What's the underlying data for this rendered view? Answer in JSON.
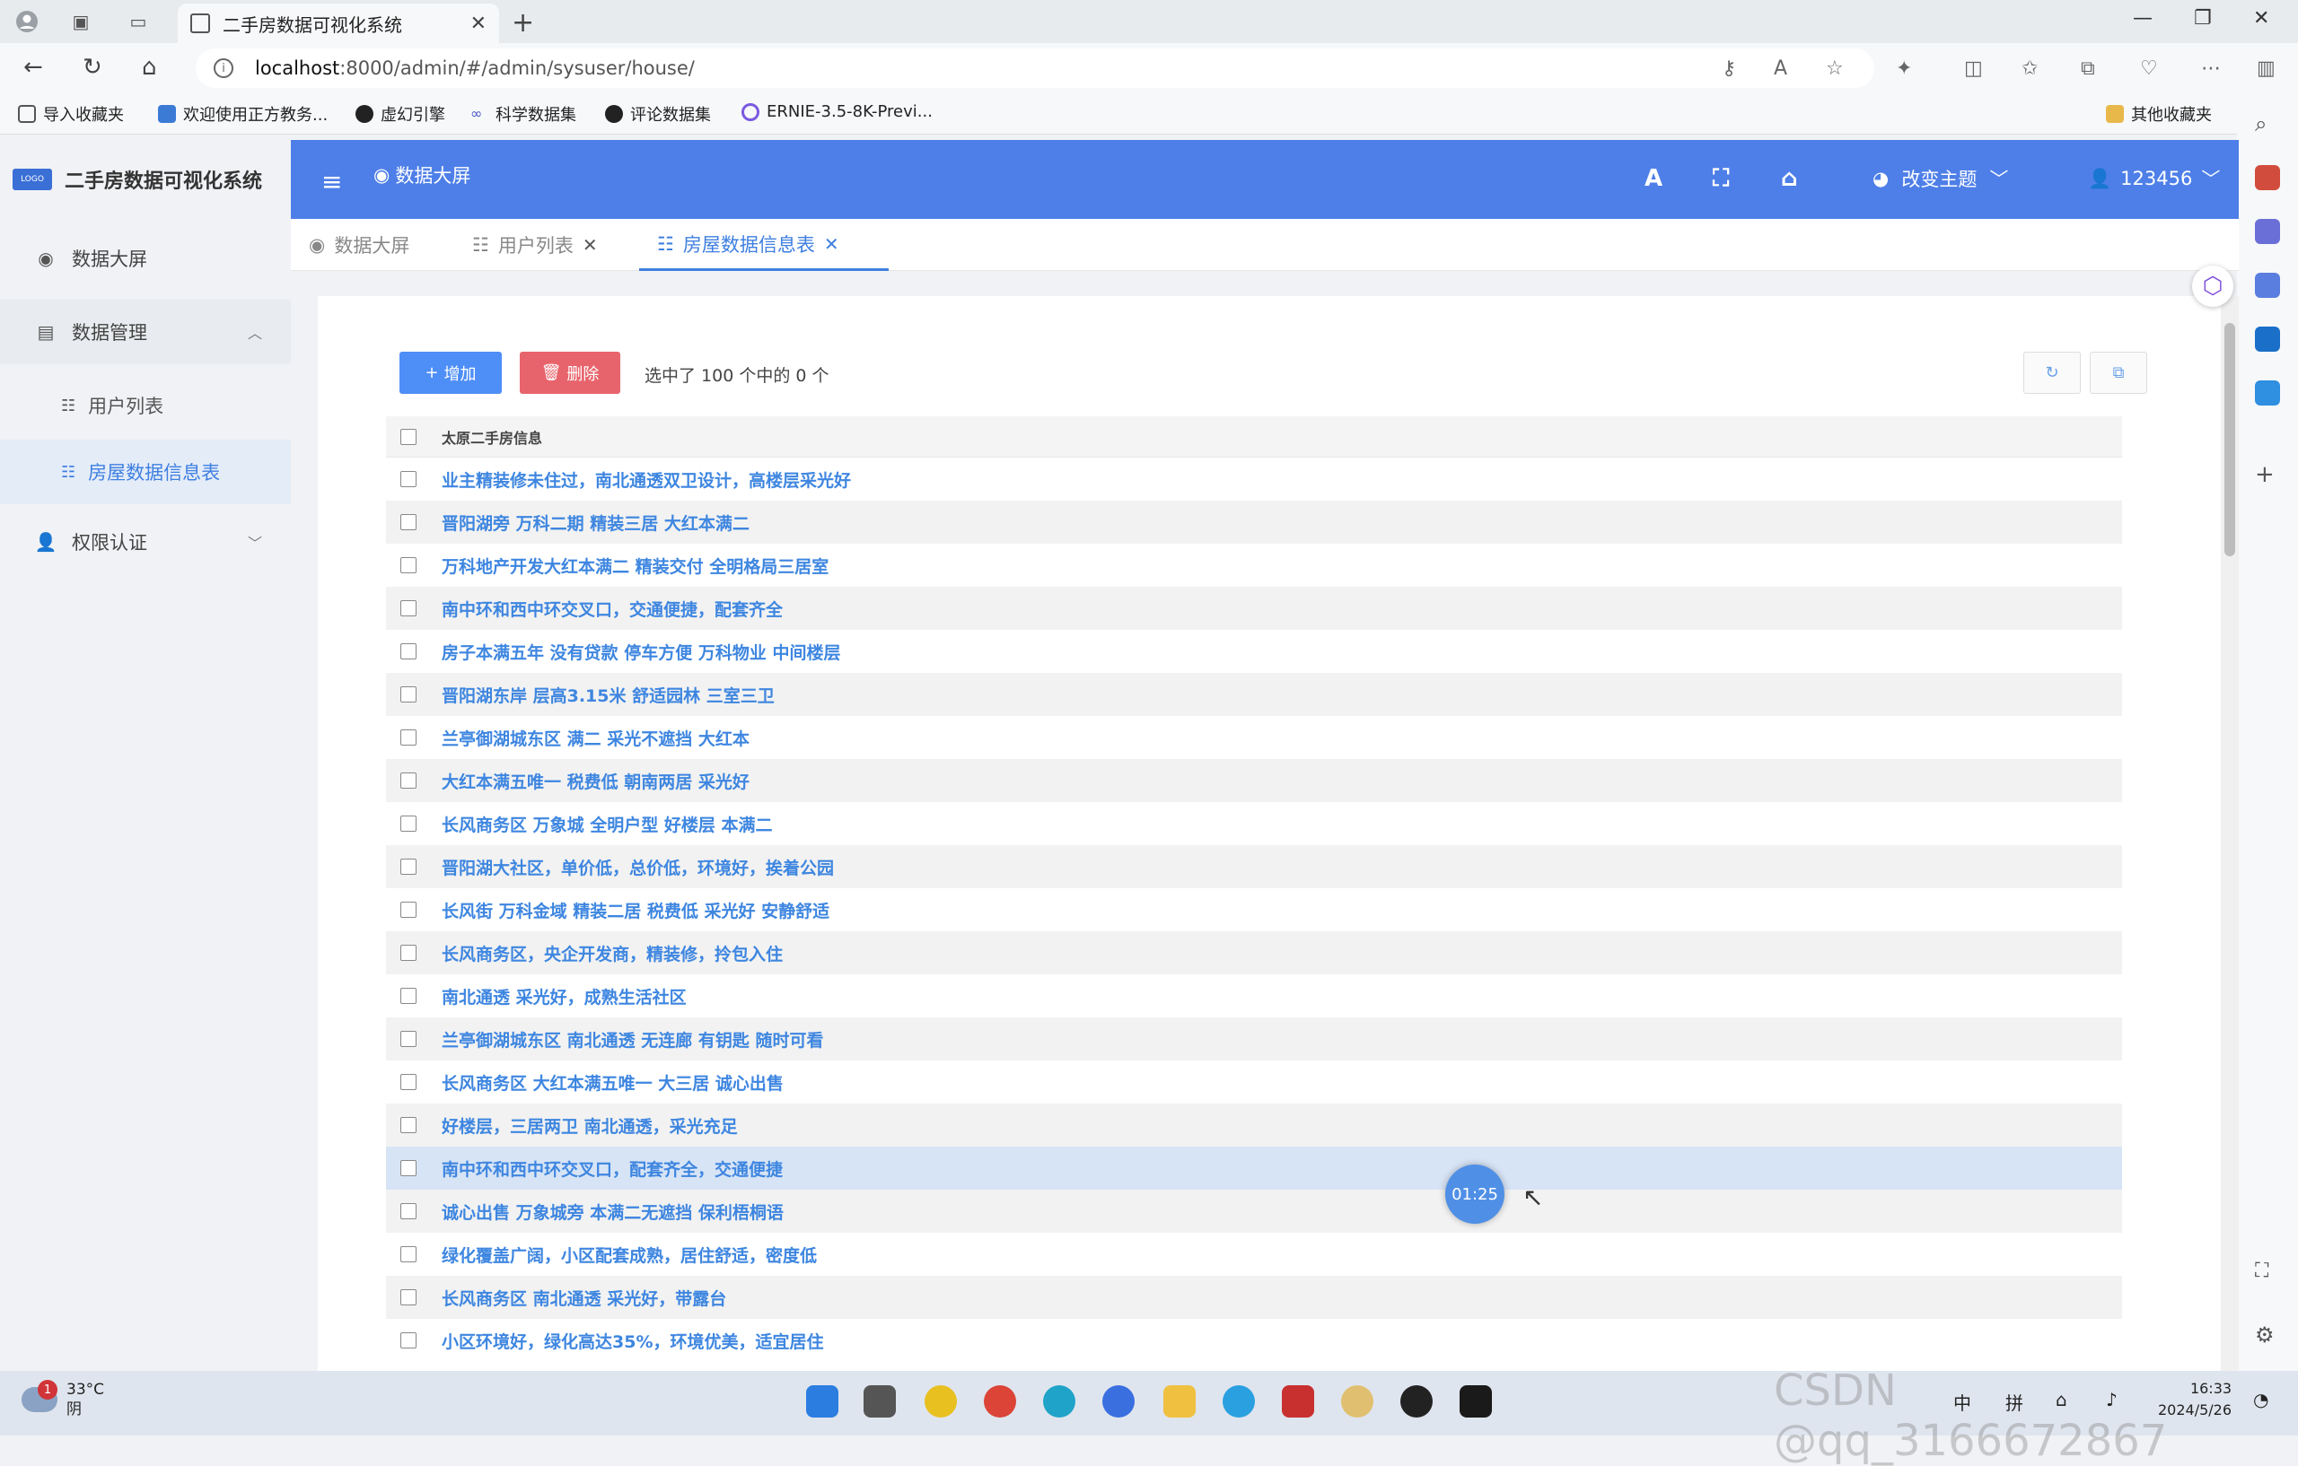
{
  "browser": {
    "tab_title": "二手房数据可视化系统",
    "url_host": "localhost",
    "url_path": ":8000/admin/#/admin/sysuser/house/",
    "bookmarks": [
      "导入收藏夹",
      "欢迎使用正方教务...",
      "虚幻引擎",
      "科学数据集",
      "评论数据集",
      "ERNIE-3.5-8K-Previ..."
    ],
    "other_bookmarks": "其他收藏夹"
  },
  "app": {
    "brand": "二手房数据可视化系统",
    "logo_text": "LOGO",
    "header_title": "数据大屏",
    "theme_label": "改变主题",
    "user_label": "123456"
  },
  "sidebar": {
    "items": [
      {
        "label": "数据大屏"
      },
      {
        "label": "数据管理"
      },
      {
        "label": "用户列表"
      },
      {
        "label": "房屋数据信息表"
      },
      {
        "label": "权限认证"
      }
    ]
  },
  "page_tabs": [
    {
      "label": "数据大屏"
    },
    {
      "label": "用户列表"
    },
    {
      "label": "房屋数据信息表"
    }
  ],
  "toolbar": {
    "add_label": "增加",
    "delete_label": "删除",
    "selection_info": "选中了 100 个中的 0 个"
  },
  "table": {
    "header": "太原二手房信息",
    "rows": [
      "业主精装修未住过，南北通透双卫设计，高楼层采光好",
      "晋阳湖旁 万科二期 精装三居 大红本满二",
      "万科地产开发大红本满二 精装交付 全明格局三居室",
      "南中环和西中环交叉口，交通便捷，配套齐全",
      "房子本满五年 没有贷款 停车方便 万科物业 中间楼层",
      "晋阳湖东岸 层高3.15米 舒适园林 三室三卫",
      "兰亭御湖城东区 满二 采光不遮挡 大红本",
      "大红本满五唯一 税费低 朝南两居 采光好",
      "长风商务区 万象城 全明户型 好楼层 本满二",
      "晋阳湖大社区，单价低，总价低，环境好，挨着公园",
      "长风街 万科金域 精装二居 税费低 采光好 安静舒适",
      "长风商务区，央企开发商，精装修，拎包入住",
      "南北通透 采光好，成熟生活社区",
      "兰亭御湖城东区 南北通透 无连廊 有钥匙 随时可看",
      "长风商务区 大红本满五唯一 大三居 诚心出售",
      "好楼层，三居两卫 南北通透，采光充足",
      "南中环和西中环交叉口，配套齐全，交通便捷",
      "诚心出售 万象城旁 本满二无遮挡 保利梧桐语",
      "绿化覆盖广阔，小区配套成熟，居住舒适，密度低",
      "长风商务区 南北通透 采光好，带露台",
      "小区环境好，绿化高达35%，环境优美，适宜居住"
    ],
    "highlighted_row": 16
  },
  "overlay": {
    "timer": "01:25"
  },
  "taskbar": {
    "weather_temp": "33°C",
    "weather_desc": "阴",
    "weather_badge": "1",
    "ime_1": "中",
    "ime_2": "拼",
    "time": "16:33",
    "date": "2024/5/26"
  },
  "watermark": "CSDN @qq_3166672867",
  "colors": {
    "header_bg": "#4e7fe8",
    "link": "#3e86e0",
    "add_btn": "#4e8ef7",
    "delete_btn": "#e8646c",
    "active_sub": "#e4ecf8"
  }
}
